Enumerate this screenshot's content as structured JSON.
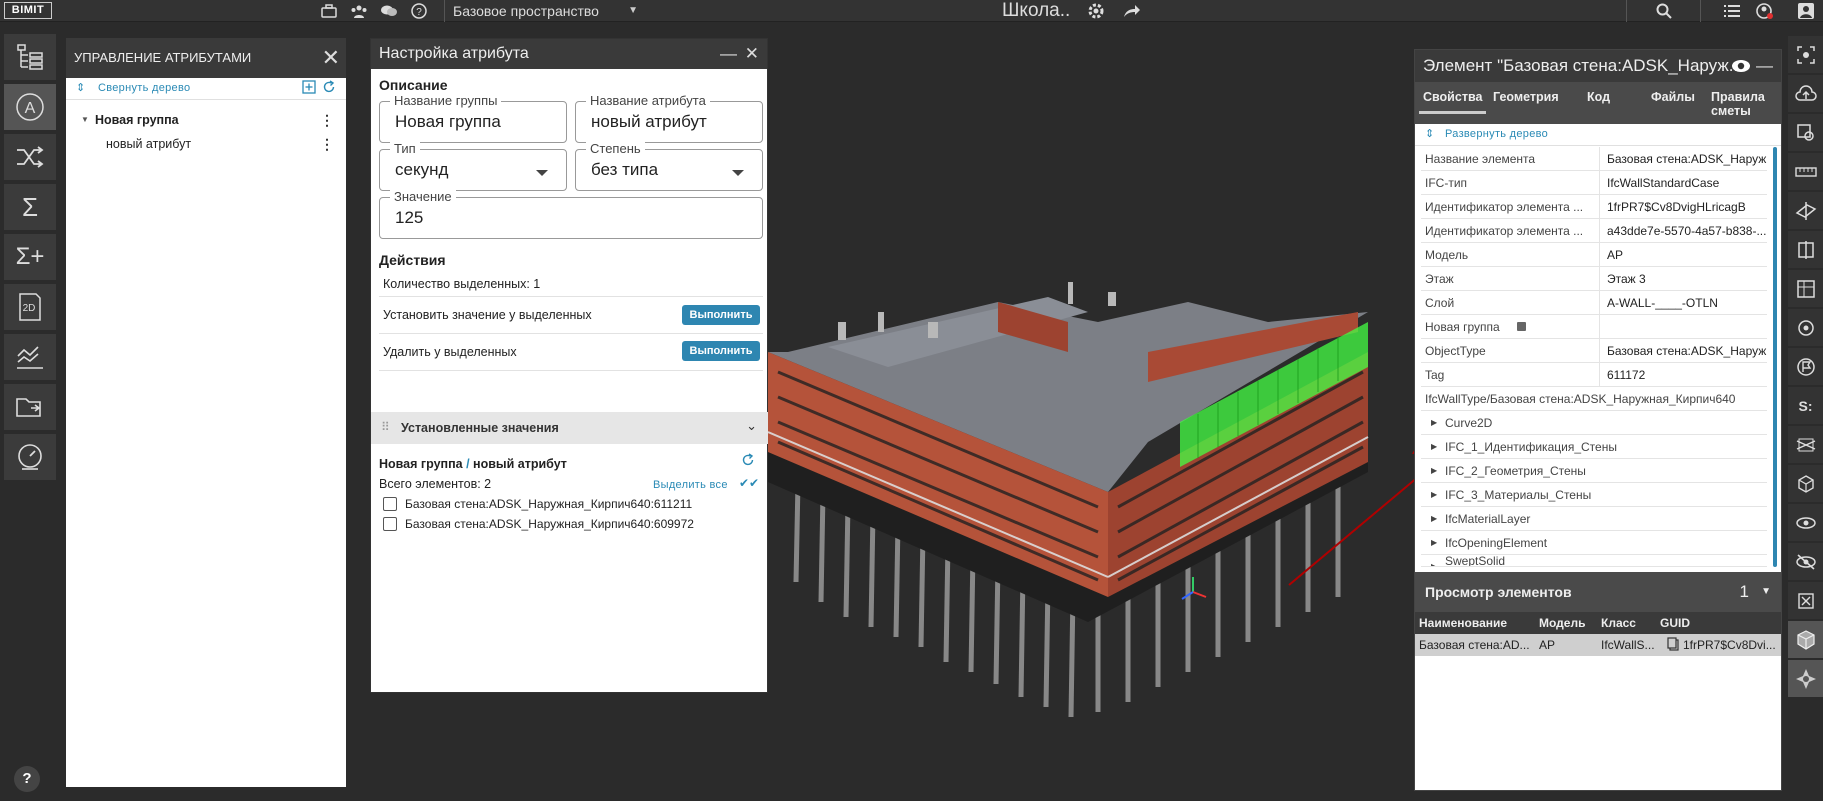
{
  "topbar": {
    "logo": "BIMIT",
    "workspace": "Базовое пространство",
    "project_title": "Школа..",
    "icons": [
      "briefcase-icon",
      "users-icon",
      "chat-icon",
      "help-icon",
      "gear-icon",
      "share-icon",
      "search-icon",
      "list-icon",
      "notifications-icon",
      "user-icon"
    ]
  },
  "left_toolbar": {
    "items": [
      "tree-icon",
      "attribute-icon",
      "shuffle-icon",
      "sum-icon",
      "sum-plus-icon",
      "2d-icon",
      "chart-icon",
      "folder-icon",
      "gauge-icon"
    ],
    "label_2d": "2D",
    "label_a": "A",
    "help": "?"
  },
  "attr_panel": {
    "title": "УПРАВЛЕНИЕ АТРИБУТАМИ",
    "collapse_tree": "Свернуть дерево",
    "group": "Новая группа",
    "attribute": "новый атрибут"
  },
  "settings": {
    "title": "Настройка атрибута",
    "description_title": "Описание",
    "group_name_label": "Название группы",
    "group_name_value": "Новая группа",
    "attr_name_label": "Название атрибута",
    "attr_name_value": "новый атрибут",
    "type_label": "Тип",
    "type_value": "секунд",
    "degree_label": "Степень",
    "degree_value": "без типа",
    "value_label": "Значение",
    "value_value": "125",
    "actions_title": "Действия",
    "selected_count": "Количество выделенных: 1",
    "set_value_label": "Установить значение у выделенных",
    "delete_label": "Удалить у выделенных",
    "execute": "Выполнить",
    "installed_title": "Установленные значения",
    "path_group": "Новая группа",
    "path_sep": "/",
    "path_attr": "новый атрибут",
    "total": "Всего элементов: 2",
    "select_all": "Выделить все",
    "items": [
      "Базовая стена:ADSK_Наружная_Кирпич640:611211",
      "Базовая стена:ADSK_Наружная_Кирпич640:609972"
    ]
  },
  "props": {
    "title": "Элемент \"Базовая стена:ADSK_Наруж...",
    "tabs": [
      "Свойства",
      "Геометрия",
      "Код",
      "Файлы",
      "Правила сметы"
    ],
    "tab_rules_line1": "Правила",
    "tab_rules_line2": "сметы",
    "expand_tree": "Развернуть дерево",
    "rows": [
      {
        "k": "Название элемента",
        "v": "Базовая стена:ADSK_Наруж..."
      },
      {
        "k": "IFC-тип",
        "v": "IfcWallStandardCase"
      },
      {
        "k": "Идентификатор элемента ...",
        "v": "1frPR7$Cv8DvigHLricagB"
      },
      {
        "k": "Идентификатор элемента ...",
        "v": "a43dde7e-5570-4a57-b838-..."
      },
      {
        "k": "Модель",
        "v": "АР"
      },
      {
        "k": "Этаж",
        "v": "Этаж 3"
      },
      {
        "k": "Слой",
        "v": "A-WALL-____-OTLN"
      },
      {
        "k": "Новая группа",
        "v": ""
      },
      {
        "k": "ObjectType",
        "v": "Базовая стена:ADSK_Наруж..."
      },
      {
        "k": "Tag",
        "v": "611172"
      }
    ],
    "type_line": "IfcWallType/Базовая стена:ADSK_Наружная_Кирпич640",
    "groups": [
      "Curve2D",
      "IFC_1_Идентификация_Стены",
      "IFC_2_Геометрия_Стены",
      "IFC_3_Материалы_Стены",
      "IfcMaterialLayer",
      "IfcOpeningElement",
      "SweptSolid"
    ],
    "viewer_title": "Просмотр элементов",
    "viewer_count": "1",
    "cols": [
      "Наименование",
      "Модель",
      "Класс",
      "GUID"
    ],
    "row": [
      "Базовая стена:AD...",
      "АР",
      "IfcWallS...",
      "1frPR7$Cv8Dvi..."
    ]
  },
  "colors": {
    "accent": "#2e86b1",
    "highlight": "#44ff44",
    "brick": "#b5533a"
  }
}
